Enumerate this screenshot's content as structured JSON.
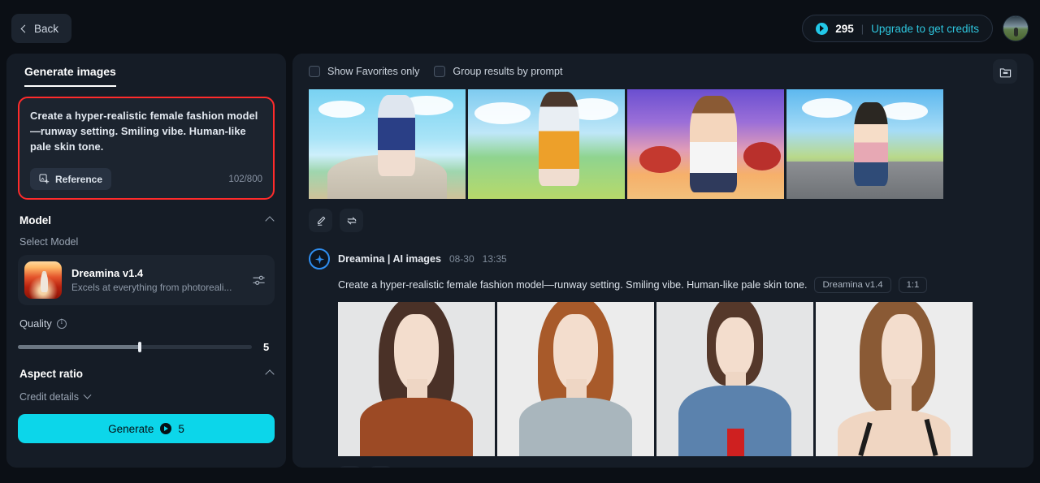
{
  "topbar": {
    "back_label": "Back",
    "credits_count": "295",
    "credits_separator": "|",
    "upgrade_label": "Upgrade to get credits",
    "avatar_name": "user-avatar"
  },
  "left_panel": {
    "tab_label": "Generate images",
    "prompt": {
      "text": "Create a hyper-realistic female fashion model—runway setting. Smiling vibe. Human-like pale skin tone.",
      "reference_label": "Reference",
      "char_count": "102/800",
      "highlight_color": "#ff2b2b"
    },
    "model_section": {
      "title": "Model",
      "select_label": "Select Model",
      "model_name": "Dreamina v1.4",
      "model_desc": "Excels at everything from photoreali..."
    },
    "quality": {
      "label": "Quality",
      "value": "5",
      "fill_percent": 52
    },
    "aspect_ratio": {
      "title": "Aspect ratio"
    },
    "credit_details_label": "Credit details",
    "generate": {
      "label": "Generate",
      "cost": "5",
      "color": "#0cd6ea"
    }
  },
  "right_panel": {
    "toolbar": {
      "show_favorites_label": "Show Favorites only",
      "group_results_label": "Group results by prompt",
      "show_favorites_checked": false,
      "group_results_checked": false,
      "archive_icon": "folder-icon"
    },
    "top_row": {
      "images": [
        {
          "alt": "anime girl in navy skirt on lakeside path"
        },
        {
          "alt": "anime girl in orange skirt on green hillside"
        },
        {
          "alt": "3d cartoon girl with plaid shirt purple mountains"
        },
        {
          "alt": "anime girl in denim shorts on country road"
        }
      ],
      "actions": [
        {
          "icon": "pencil-icon",
          "label": "Edit"
        },
        {
          "icon": "regenerate-icon",
          "label": "Regenerate"
        }
      ]
    },
    "result_group": {
      "brand_icon": "dreamina-star-icon",
      "title": "Dreamina | AI images",
      "date": "08-30",
      "time": "13:35",
      "prompt": "Create a hyper-realistic female fashion model—runway setting. Smiling vibe. Human-like pale skin tone.",
      "tags": [
        "Dreamina v1.4",
        "1:1"
      ],
      "images": [
        {
          "alt": "model in rust turtleneck sweater"
        },
        {
          "alt": "red-haired model in grey sleeveless top"
        },
        {
          "alt": "model in denim jacket with red top"
        },
        {
          "alt": "model in black strappy top"
        }
      ]
    }
  }
}
